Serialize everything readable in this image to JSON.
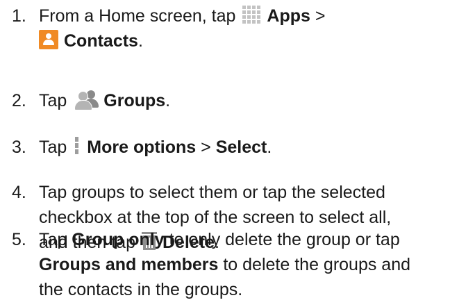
{
  "steps": [
    {
      "num": "1.",
      "t1": "From a Home screen, tap",
      "t2": "Apps",
      "t3": ">",
      "t4": "Contacts",
      "t5": "."
    },
    {
      "num": "2.",
      "t1": "Tap",
      "t2": "Groups",
      "t3": "."
    },
    {
      "num": "3.",
      "t1": "Tap",
      "t2": "More options",
      "t3": ">",
      "t4": "Select",
      "t5": "."
    },
    {
      "num": "4.",
      "l1": "Tap groups to select them or tap the selected",
      "l2": "checkbox at the top of the screen to select all,",
      "l3a": "and then tap",
      "l3b": "Delete",
      "l3c": "."
    },
    {
      "num": "5.",
      "l1a": "Tap",
      "l1b": "Group only",
      "l1c": "to only delete the group or tap",
      "l2a": "Groups and members",
      "l2b": "to delete the groups and",
      "l3": "the contacts in the groups."
    }
  ],
  "icons": {
    "apps": "apps-grid-icon",
    "contacts": "contacts-icon",
    "groups": "groups-icon",
    "more_options": "more-options-icon",
    "delete": "trash-icon",
    "contacts_color": "#f08a24"
  }
}
